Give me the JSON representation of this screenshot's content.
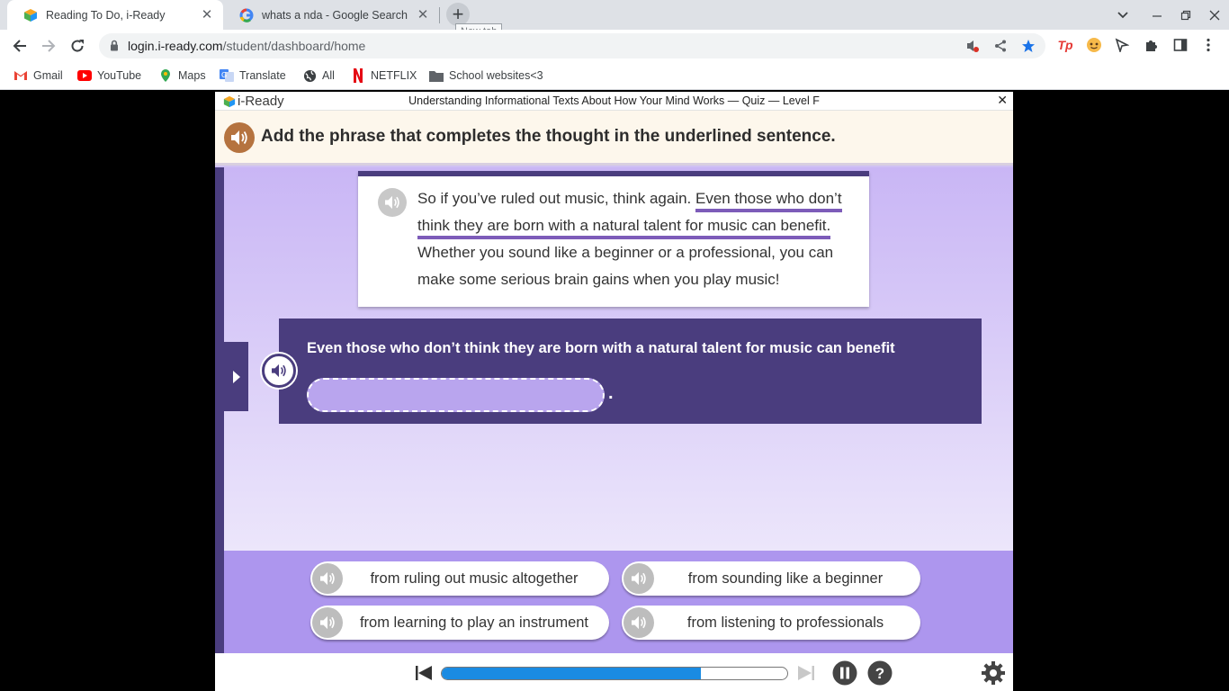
{
  "browser": {
    "tabs": [
      {
        "title": "Reading To Do, i-Ready",
        "active": true
      },
      {
        "title": "whats a nda - Google Search",
        "active": false
      }
    ],
    "new_tab_tooltip": "New tab",
    "url_host": "login.i-ready.com",
    "url_path": "/student/dashboard/home",
    "bookmarks": [
      {
        "label": "Gmail",
        "icon": "gmail-icon"
      },
      {
        "label": "YouTube",
        "icon": "youtube-icon"
      },
      {
        "label": "Maps",
        "icon": "maps-icon"
      },
      {
        "label": "Translate",
        "icon": "translate-icon"
      },
      {
        "label": "All",
        "icon": "globe-icon"
      },
      {
        "label": "NETFLIX",
        "icon": "netflix-icon"
      },
      {
        "label": "School websites<3",
        "icon": "folder-icon"
      }
    ]
  },
  "iready": {
    "logo": "i-Ready",
    "quiz_title": "Understanding Informational Texts About How Your Mind Works — Quiz — Level F",
    "instruction": "Add the phrase that completes the thought in the underlined sentence.",
    "passage": {
      "pre": "So if you’ve ruled out music, think again. ",
      "underlined": "Even those who don’t think they are born with a natural talent for music can benefit.",
      "post": " Whether you sound like a beginner or a professional, you can make some serious brain gains when you play music!"
    },
    "question": "Even those who don’t think they are born with a natural talent for music can benefit",
    "question_end": ".",
    "choices": [
      "from ruling out music altogether",
      "from sounding like a beginner",
      "from learning to play an instrument",
      "from listening to professionals"
    ],
    "progress_fraction": 0.75,
    "colors": {
      "accent_purple": "#4a3d7e",
      "progress_blue": "#1a8be2",
      "speaker_brown": "#b5733f"
    }
  }
}
